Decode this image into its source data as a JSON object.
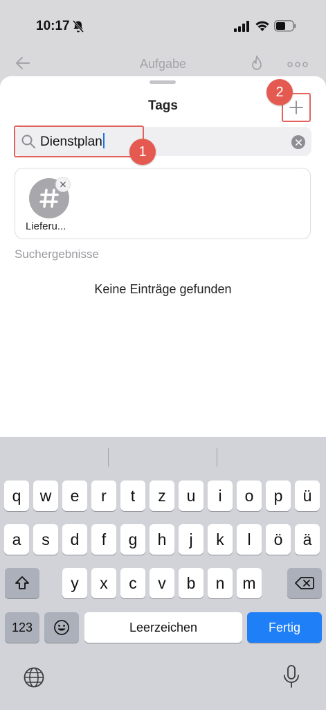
{
  "status_bar": {
    "time": "10:17"
  },
  "background_nav": {
    "title": "Aufgabe"
  },
  "sheet": {
    "title": "Tags",
    "search": {
      "value": "Dienstplan"
    },
    "selected_tags": [
      {
        "label": "Lieferu..."
      }
    ],
    "results_header": "Suchergebnisse",
    "empty_message": "Keine Einträge gefunden"
  },
  "annotations": {
    "badge_1": "1",
    "badge_2": "2"
  },
  "keyboard": {
    "row1": [
      "q",
      "w",
      "e",
      "r",
      "t",
      "z",
      "u",
      "i",
      "o",
      "p",
      "ü"
    ],
    "row2": [
      "a",
      "s",
      "d",
      "f",
      "g",
      "h",
      "j",
      "k",
      "l",
      "ö",
      "ä"
    ],
    "row3": [
      "y",
      "x",
      "c",
      "v",
      "b",
      "n",
      "m"
    ],
    "numbers_key": "123",
    "space_key": "Leerzeichen",
    "return_key": "Fertig"
  },
  "colors": {
    "accent": "#1f7ff6",
    "annotation": "#e55a50",
    "keyboard_bg": "#d1d3d9"
  }
}
